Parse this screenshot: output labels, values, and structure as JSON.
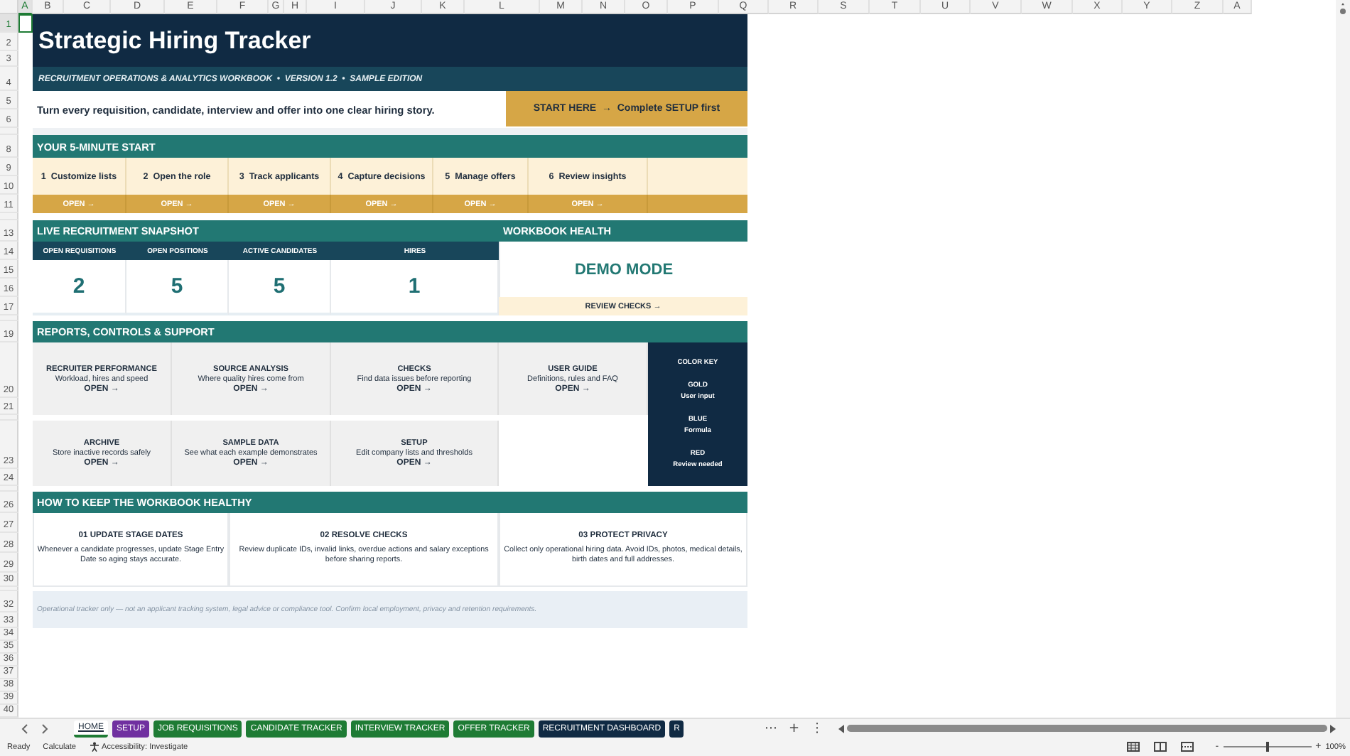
{
  "column_headers": [
    "A",
    "B",
    "C",
    "D",
    "E",
    "F",
    "G",
    "H",
    "I",
    "J",
    "K",
    "L",
    "M",
    "N",
    "O",
    "P",
    "Q",
    "R",
    "S",
    "T",
    "U",
    "V",
    "W",
    "X",
    "Y",
    "Z",
    "A"
  ],
  "row_headers": [
    "1",
    "2",
    "3",
    "4",
    "5",
    "6",
    "8",
    "9",
    "10",
    "11",
    "13",
    "14",
    "15",
    "16",
    "17",
    "19",
    "20",
    "21",
    "23",
    "24",
    "26",
    "27",
    "28",
    "29",
    "30",
    "32",
    "33",
    "34",
    "35",
    "36",
    "37",
    "38",
    "39",
    "40"
  ],
  "header": {
    "title": "Strategic Hiring Tracker",
    "subtitle": "RECRUITMENT OPERATIONS & ANALYTICS WORKBOOK  •  VERSION 1.2  •  SAMPLE EDITION",
    "tagline": "Turn every requisition, candidate, interview and offer into one clear hiring story.",
    "start_button": "START HERE  →  Complete SETUP first"
  },
  "start_section": {
    "heading": "YOUR 5-MINUTE START",
    "steps": [
      {
        "label": "1  Customize lists",
        "action": "OPEN →"
      },
      {
        "label": "2  Open the role",
        "action": "OPEN →"
      },
      {
        "label": "3  Track applicants",
        "action": "OPEN →"
      },
      {
        "label": "4  Capture decisions",
        "action": "OPEN →"
      },
      {
        "label": "5  Manage offers",
        "action": "OPEN →"
      },
      {
        "label": "6  Review insights",
        "action": "OPEN →"
      }
    ]
  },
  "snapshot": {
    "heading": "LIVE RECRUITMENT SNAPSHOT",
    "kpis": [
      {
        "label": "OPEN REQUISITIONS",
        "value": "2"
      },
      {
        "label": "OPEN POSITIONS",
        "value": "5"
      },
      {
        "label": "ACTIVE CANDIDATES",
        "value": "5"
      },
      {
        "label": "HIRES",
        "value": "1"
      }
    ],
    "health": {
      "heading": "WORKBOOK HEALTH",
      "status": "DEMO MODE",
      "action": "REVIEW CHECKS →"
    }
  },
  "reports": {
    "heading": "REPORTS, CONTROLS & SUPPORT",
    "cards": [
      {
        "title": "RECRUITER PERFORMANCE",
        "description": "Workload, hires and speed",
        "action": "OPEN →"
      },
      {
        "title": "SOURCE ANALYSIS",
        "description": "Where quality hires come from",
        "action": "OPEN →"
      },
      {
        "title": "CHECKS",
        "description": "Find data issues before reporting",
        "action": "OPEN →"
      },
      {
        "title": "USER GUIDE",
        "description": "Definitions, rules and FAQ",
        "action": "OPEN →"
      },
      {
        "title": "ARCHIVE",
        "description": "Store inactive records safely",
        "action": "OPEN →"
      },
      {
        "title": "SAMPLE DATA",
        "description": "See what each example demonstrates",
        "action": "OPEN →"
      },
      {
        "title": "SETUP",
        "description": "Edit company lists and thresholds",
        "action": "OPEN →"
      }
    ],
    "color_key": {
      "title": "COLOR KEY",
      "entries": [
        {
          "name": "GOLD",
          "meaning": "User input"
        },
        {
          "name": "BLUE",
          "meaning": "Formula"
        },
        {
          "name": "RED",
          "meaning": "Review needed"
        }
      ]
    }
  },
  "healthy": {
    "heading": "HOW TO KEEP THE WORKBOOK HEALTHY",
    "tips": [
      {
        "title": "01  UPDATE STAGE DATES",
        "text": "Whenever a candidate progresses, update Stage Entry Date so aging stays accurate."
      },
      {
        "title": "02  RESOLVE CHECKS",
        "text": "Review duplicate IDs, invalid links, overdue actions and salary exceptions before sharing reports."
      },
      {
        "title": "03  PROTECT PRIVACY",
        "text": "Collect only operational hiring data. Avoid IDs, photos, medical details, birth dates and full addresses."
      }
    ]
  },
  "disclaimer": "Operational tracker only — not an applicant tracking system, legal advice or compliance tool. Confirm local employment, privacy and retention requirements.",
  "sheet_tabs": [
    {
      "label": "HOME",
      "selected": true
    },
    {
      "label": "SETUP",
      "selected": false,
      "color": "#7030a0"
    },
    {
      "label": "JOB REQUISITIONS",
      "selected": false,
      "color": "#1e7b34"
    },
    {
      "label": "CANDIDATE TRACKER",
      "selected": false,
      "color": "#1e7b34"
    },
    {
      "label": "INTERVIEW TRACKER",
      "selected": false,
      "color": "#1e7b34"
    },
    {
      "label": "OFFER TRACKER",
      "selected": false,
      "color": "#1e7b34"
    },
    {
      "label": "RECRUITMENT DASHBOARD",
      "selected": false,
      "color": "#102a43"
    },
    {
      "label": "R",
      "selected": false,
      "color": "#102a43"
    }
  ],
  "tab_controls": {
    "more": "⋯",
    "add": "+",
    "options": "⋮"
  },
  "status_bar": {
    "ready": "Ready",
    "calculate": "Calculate",
    "accessibility": "Accessibility: Investigate",
    "zoom_out": "-",
    "zoom_in": "+",
    "zoom": "100%",
    "zoom_slider": {
      "level": 0.5
    }
  }
}
